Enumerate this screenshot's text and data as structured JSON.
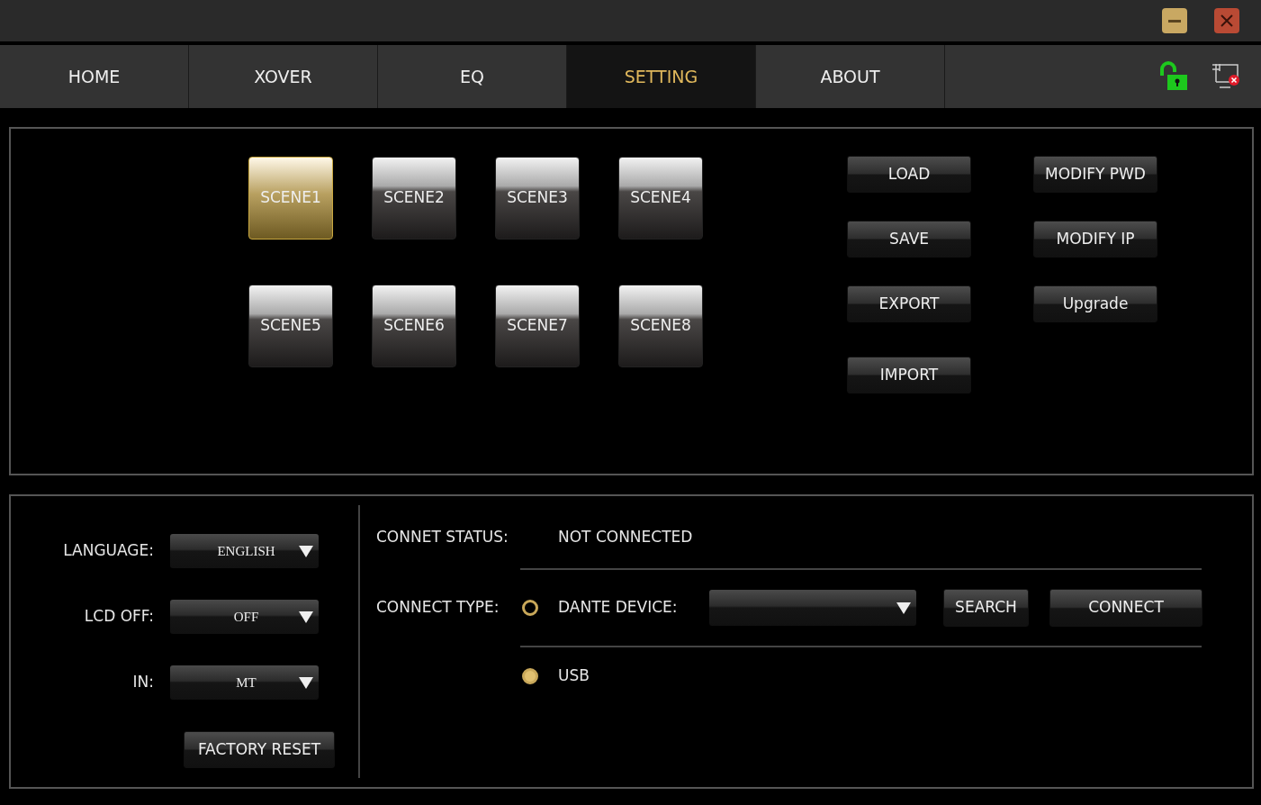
{
  "tabs": [
    {
      "label": "HOME",
      "selected": false
    },
    {
      "label": "XOVER",
      "selected": false
    },
    {
      "label": "EQ",
      "selected": false
    },
    {
      "label": "SETTING",
      "selected": true
    },
    {
      "label": "ABOUT",
      "selected": false
    }
  ],
  "scenes": [
    {
      "label": "SCENE1",
      "selected": true
    },
    {
      "label": "SCENE2",
      "selected": false
    },
    {
      "label": "SCENE3",
      "selected": false
    },
    {
      "label": "SCENE4",
      "selected": false
    },
    {
      "label": "SCENE5",
      "selected": false
    },
    {
      "label": "SCENE6",
      "selected": false
    },
    {
      "label": "SCENE7",
      "selected": false
    },
    {
      "label": "SCENE8",
      "selected": false
    }
  ],
  "file_buttons": [
    "LOAD",
    "SAVE",
    "EXPORT",
    "IMPORT"
  ],
  "admin_buttons": [
    "MODIFY PWD",
    "MODIFY IP",
    "Upgrade"
  ],
  "settings": [
    {
      "label": "LANGUAGE:",
      "value": "ENGLISH"
    },
    {
      "label": "LCD OFF:",
      "value": "OFF"
    },
    {
      "label": "IN:",
      "value": "MT"
    }
  ],
  "factory_reset": "FACTORY RESET",
  "connection": {
    "status_label": "CONNET STATUS:",
    "status_value": "NOT CONNECTED",
    "type_label": "CONNECT TYPE:",
    "options": [
      {
        "kind": "dante",
        "label": "DANTE DEVICE:",
        "selected": false
      },
      {
        "kind": "usb",
        "label": "USB",
        "selected": true
      }
    ],
    "search": "SEARCH",
    "connect": "CONNECT"
  }
}
